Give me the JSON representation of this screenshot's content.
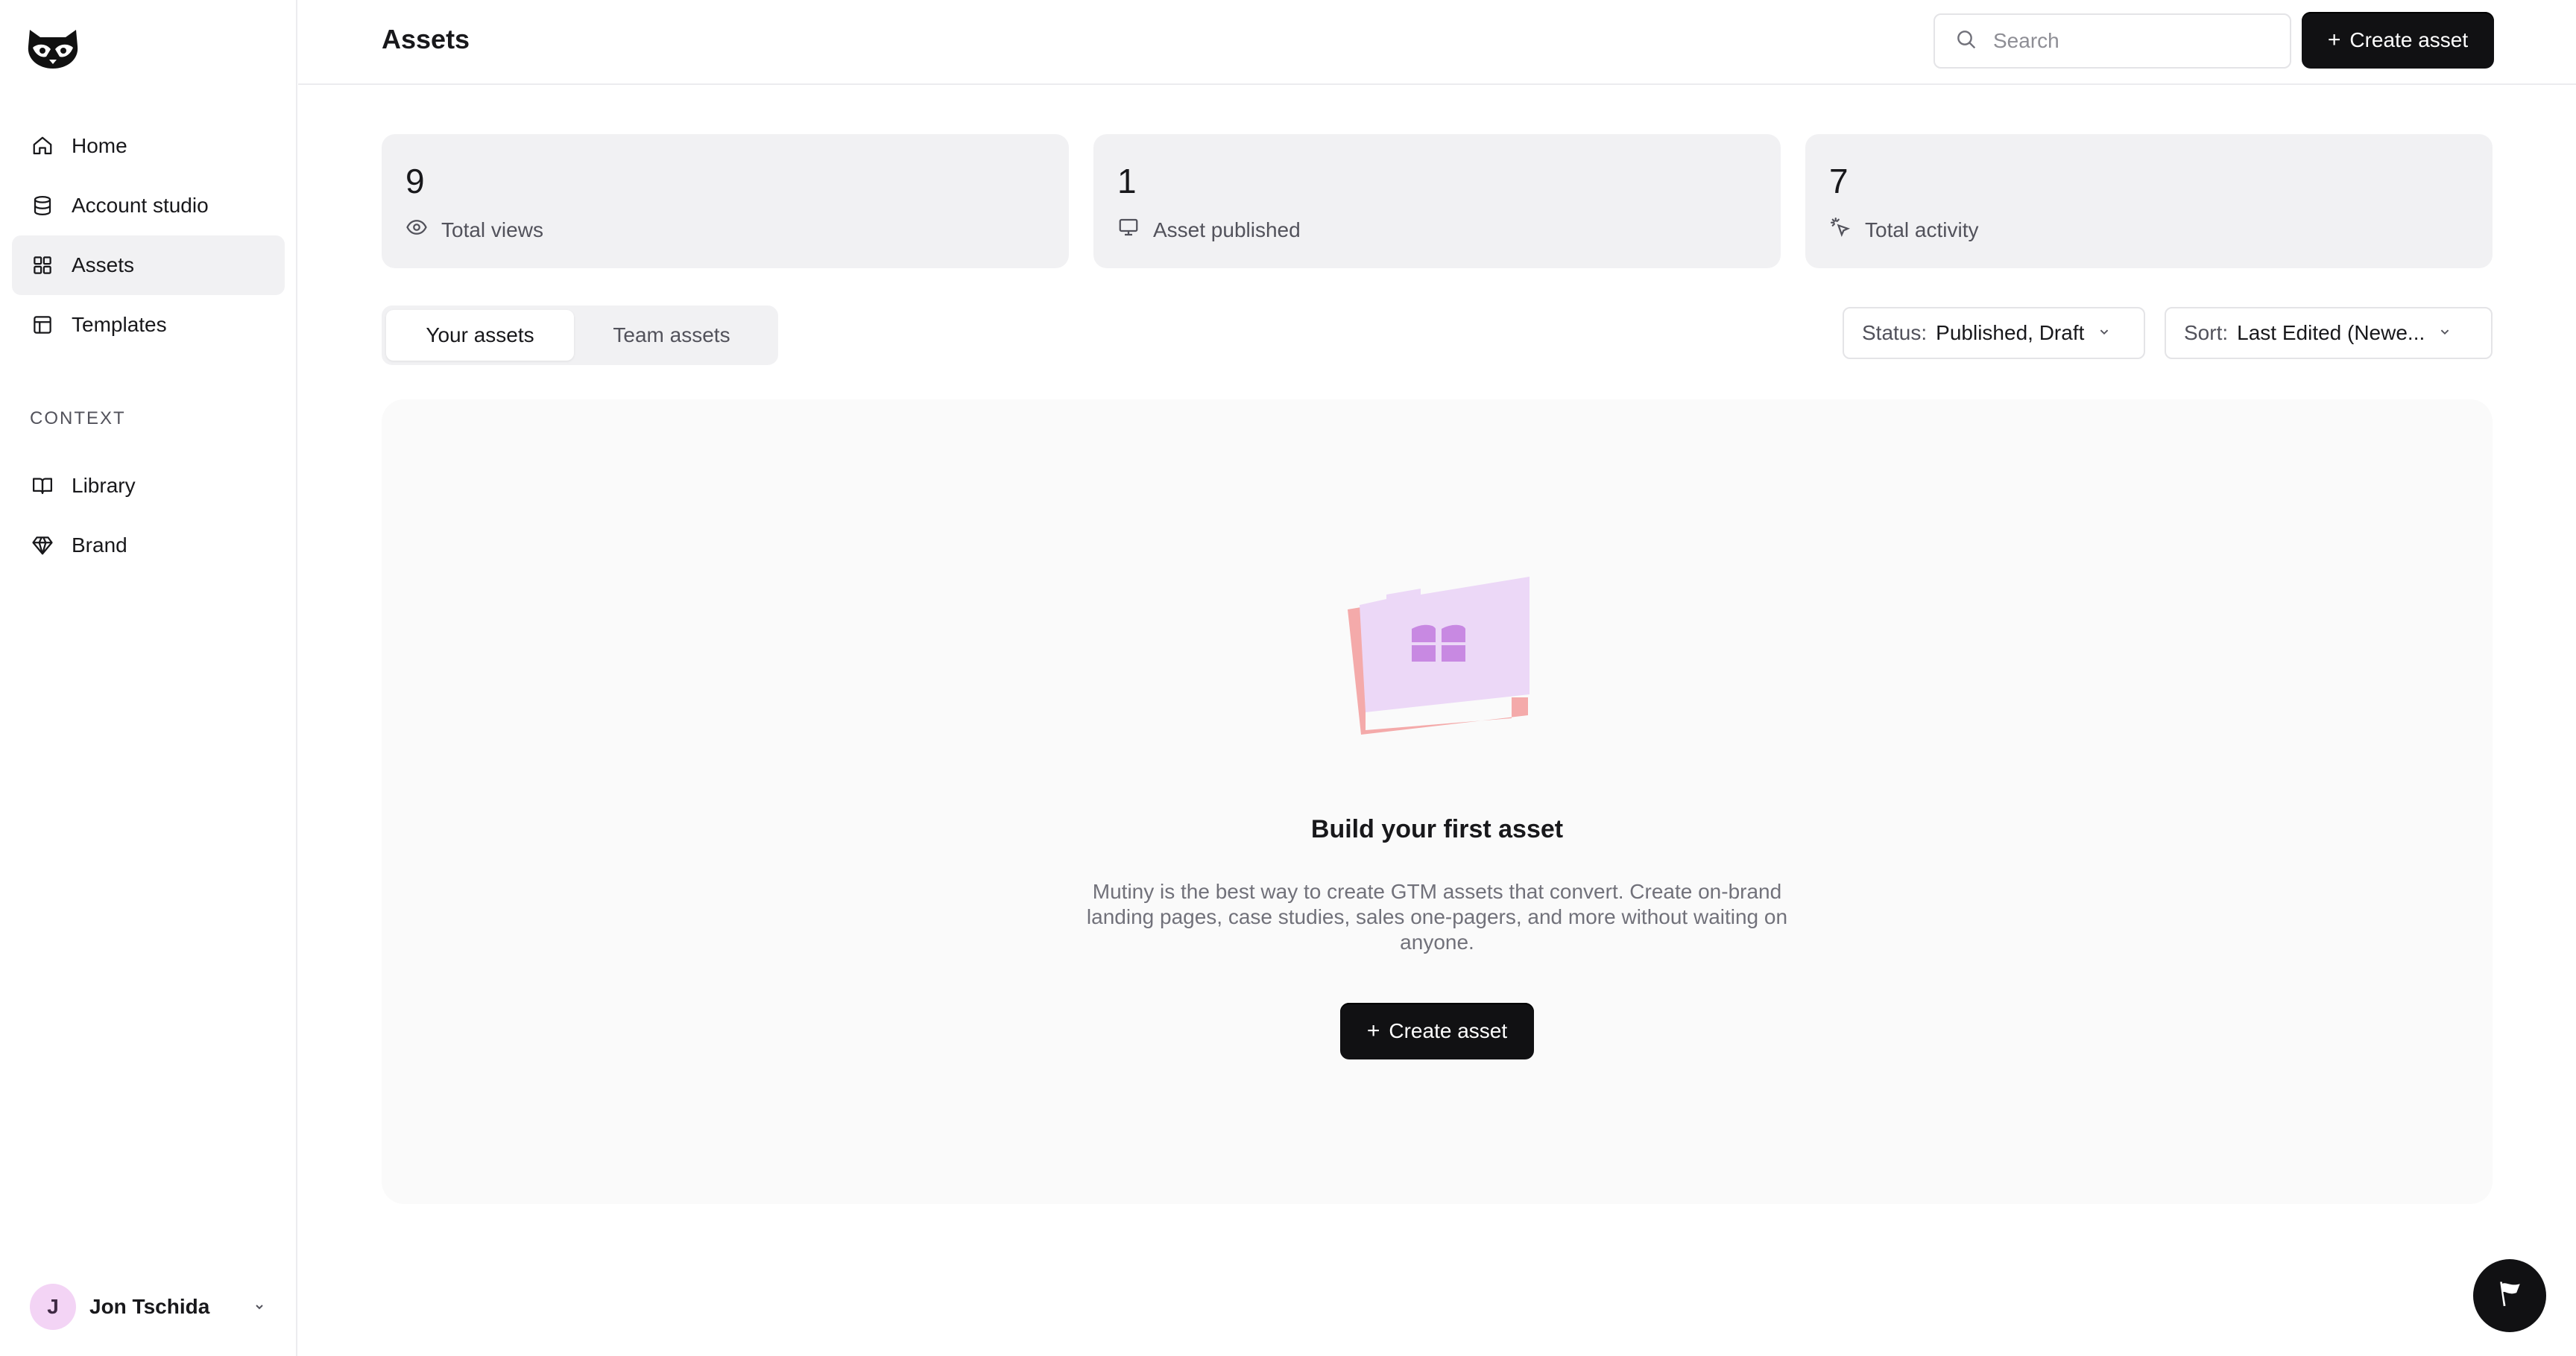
{
  "sidebar": {
    "items": [
      {
        "label": "Home",
        "icon": "home-icon"
      },
      {
        "label": "Account studio",
        "icon": "database-icon"
      },
      {
        "label": "Assets",
        "icon": "grid-icon",
        "active": true
      },
      {
        "label": "Templates",
        "icon": "layout-icon"
      }
    ],
    "section_label": "CONTEXT",
    "context_items": [
      {
        "label": "Library",
        "icon": "book-icon"
      },
      {
        "label": "Brand",
        "icon": "gem-icon"
      }
    ],
    "user": {
      "initial": "J",
      "name": "Jon Tschida"
    }
  },
  "header": {
    "title": "Assets",
    "search_placeholder": "Search",
    "create_label": "Create asset"
  },
  "stats": [
    {
      "value": "9",
      "label": "Total views",
      "icon": "eye-icon"
    },
    {
      "value": "1",
      "label": "Asset published",
      "icon": "monitor-icon"
    },
    {
      "value": "7",
      "label": "Total activity",
      "icon": "sparkle-click-icon"
    }
  ],
  "tabs": [
    {
      "label": "Your assets",
      "active": true
    },
    {
      "label": "Team assets",
      "active": false
    }
  ],
  "filters": {
    "status": {
      "key": "Status:",
      "value": "Published, Draft"
    },
    "sort": {
      "key": "Sort:",
      "value": "Last Edited (Newe..."
    }
  },
  "empty_state": {
    "title": "Build your first asset",
    "description": "Mutiny is the best way to create GTM assets that convert. Create on-brand landing pages, case studies, sales one-pagers, and more without waiting on anyone.",
    "create_label": "Create asset"
  },
  "colors": {
    "accent": "#111113",
    "active_nav_bg": "#f1f1f3",
    "stat_bg": "#f1f1f3",
    "illustration_pink": "#f4aaaa",
    "illustration_lilac": "#ecd8f7"
  }
}
